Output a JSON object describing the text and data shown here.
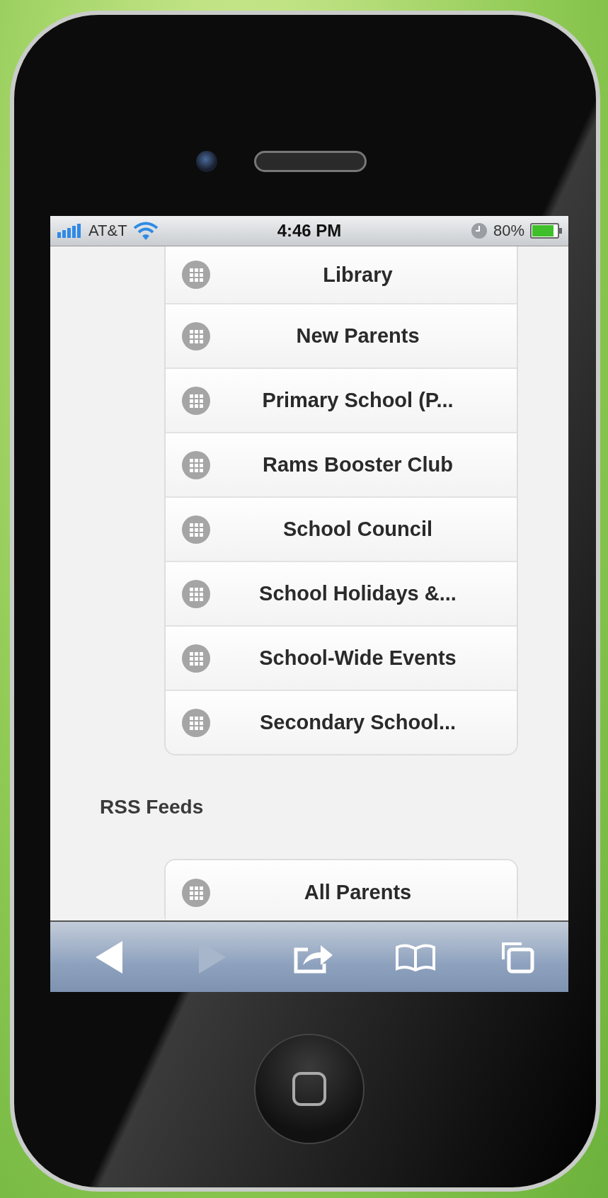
{
  "status_bar": {
    "carrier": "AT&T",
    "time": "4:46 PM",
    "battery": "80%"
  },
  "list": {
    "items": [
      {
        "label": "Library"
      },
      {
        "label": "New Parents"
      },
      {
        "label": "Primary School (P..."
      },
      {
        "label": "Rams Booster Club"
      },
      {
        "label": "School Council"
      },
      {
        "label": "School Holidays &..."
      },
      {
        "label": "School-Wide Events"
      },
      {
        "label": "Secondary School..."
      }
    ]
  },
  "rss_feeds": {
    "heading": "RSS Feeds",
    "items": [
      {
        "label": "All Parents"
      }
    ]
  },
  "toolbar": {
    "buttons": [
      {
        "kind": "back",
        "disabled": false
      },
      {
        "kind": "forward",
        "disabled": true
      },
      {
        "kind": "share",
        "disabled": false
      },
      {
        "kind": "bookmarks",
        "disabled": false
      },
      {
        "kind": "tabs",
        "disabled": false
      }
    ]
  }
}
